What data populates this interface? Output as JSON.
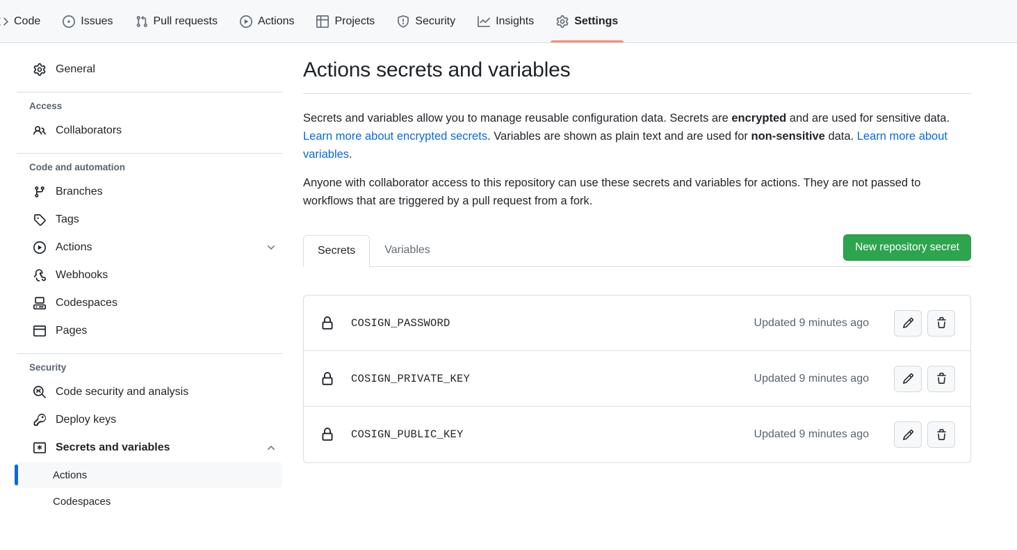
{
  "repo_nav": {
    "items": [
      {
        "label": "Code",
        "icon": "code-icon",
        "active": false
      },
      {
        "label": "Issues",
        "icon": "issue-opened-icon",
        "active": false
      },
      {
        "label": "Pull requests",
        "icon": "git-pull-request-icon",
        "active": false
      },
      {
        "label": "Actions",
        "icon": "play-icon",
        "active": false
      },
      {
        "label": "Projects",
        "icon": "table-icon",
        "active": false
      },
      {
        "label": "Security",
        "icon": "shield-icon",
        "active": false
      },
      {
        "label": "Insights",
        "icon": "graph-icon",
        "active": false
      },
      {
        "label": "Settings",
        "icon": "gear-icon",
        "active": true
      }
    ]
  },
  "sidebar": {
    "general": {
      "label": "General",
      "icon": "gear-icon"
    },
    "groups": [
      {
        "title": "Access",
        "items": [
          {
            "label": "Collaborators",
            "icon": "people-icon"
          }
        ]
      },
      {
        "title": "Code and automation",
        "items": [
          {
            "label": "Branches",
            "icon": "git-branch-icon"
          },
          {
            "label": "Tags",
            "icon": "tag-icon"
          },
          {
            "label": "Actions",
            "icon": "play-icon",
            "chevron": "chevron-down"
          },
          {
            "label": "Webhooks",
            "icon": "webhook-icon"
          },
          {
            "label": "Codespaces",
            "icon": "codespaces-icon"
          },
          {
            "label": "Pages",
            "icon": "browser-icon"
          }
        ]
      },
      {
        "title": "Security",
        "items": [
          {
            "label": "Code security and analysis",
            "icon": "codescan-icon"
          },
          {
            "label": "Deploy keys",
            "icon": "key-icon"
          },
          {
            "label": "Secrets and variables",
            "icon": "asterisk-box-icon",
            "chevron": "chevron-up",
            "bold": true
          }
        ]
      }
    ],
    "sub_items": [
      {
        "label": "Actions",
        "selected": true
      },
      {
        "label": "Codespaces",
        "selected": false
      }
    ]
  },
  "main": {
    "title": "Actions secrets and variables",
    "intro": {
      "p1_a": "Secrets and variables allow you to manage reusable configuration data. Secrets are ",
      "p1_b1": "encrypted",
      "p1_c": " and are used for sensitive data. ",
      "p1_link1": "Learn more about encrypted secrets",
      "p1_d": ". Variables are shown as plain text and are used for ",
      "p1_b2": "non-sensitive",
      "p1_e": " data. ",
      "p1_link2": "Learn more about variables",
      "p1_f": ".",
      "p2": "Anyone with collaborator access to this repository can use these secrets and variables for actions. They are not passed to workflows that are triggered by a pull request from a fork."
    },
    "tabs": [
      {
        "label": "Secrets",
        "active": true
      },
      {
        "label": "Variables",
        "active": false
      }
    ],
    "new_secret_button": "New repository secret",
    "secrets": [
      {
        "name": "COSIGN_PASSWORD",
        "updated": "Updated 9 minutes ago",
        "edit_label": "pencil-icon",
        "delete_label": "trash-icon"
      },
      {
        "name": "COSIGN_PRIVATE_KEY",
        "updated": "Updated 9 minutes ago",
        "edit_label": "pencil-icon",
        "delete_label": "trash-icon"
      },
      {
        "name": "COSIGN_PUBLIC_KEY",
        "updated": "Updated 9 minutes ago",
        "edit_label": "pencil-icon",
        "delete_label": "trash-icon"
      }
    ]
  },
  "colors": {
    "accent_green": "#2da44e",
    "active_tab_underline": "#fd8c73",
    "link_blue": "#0969da",
    "selected_bar": "#0969da"
  }
}
